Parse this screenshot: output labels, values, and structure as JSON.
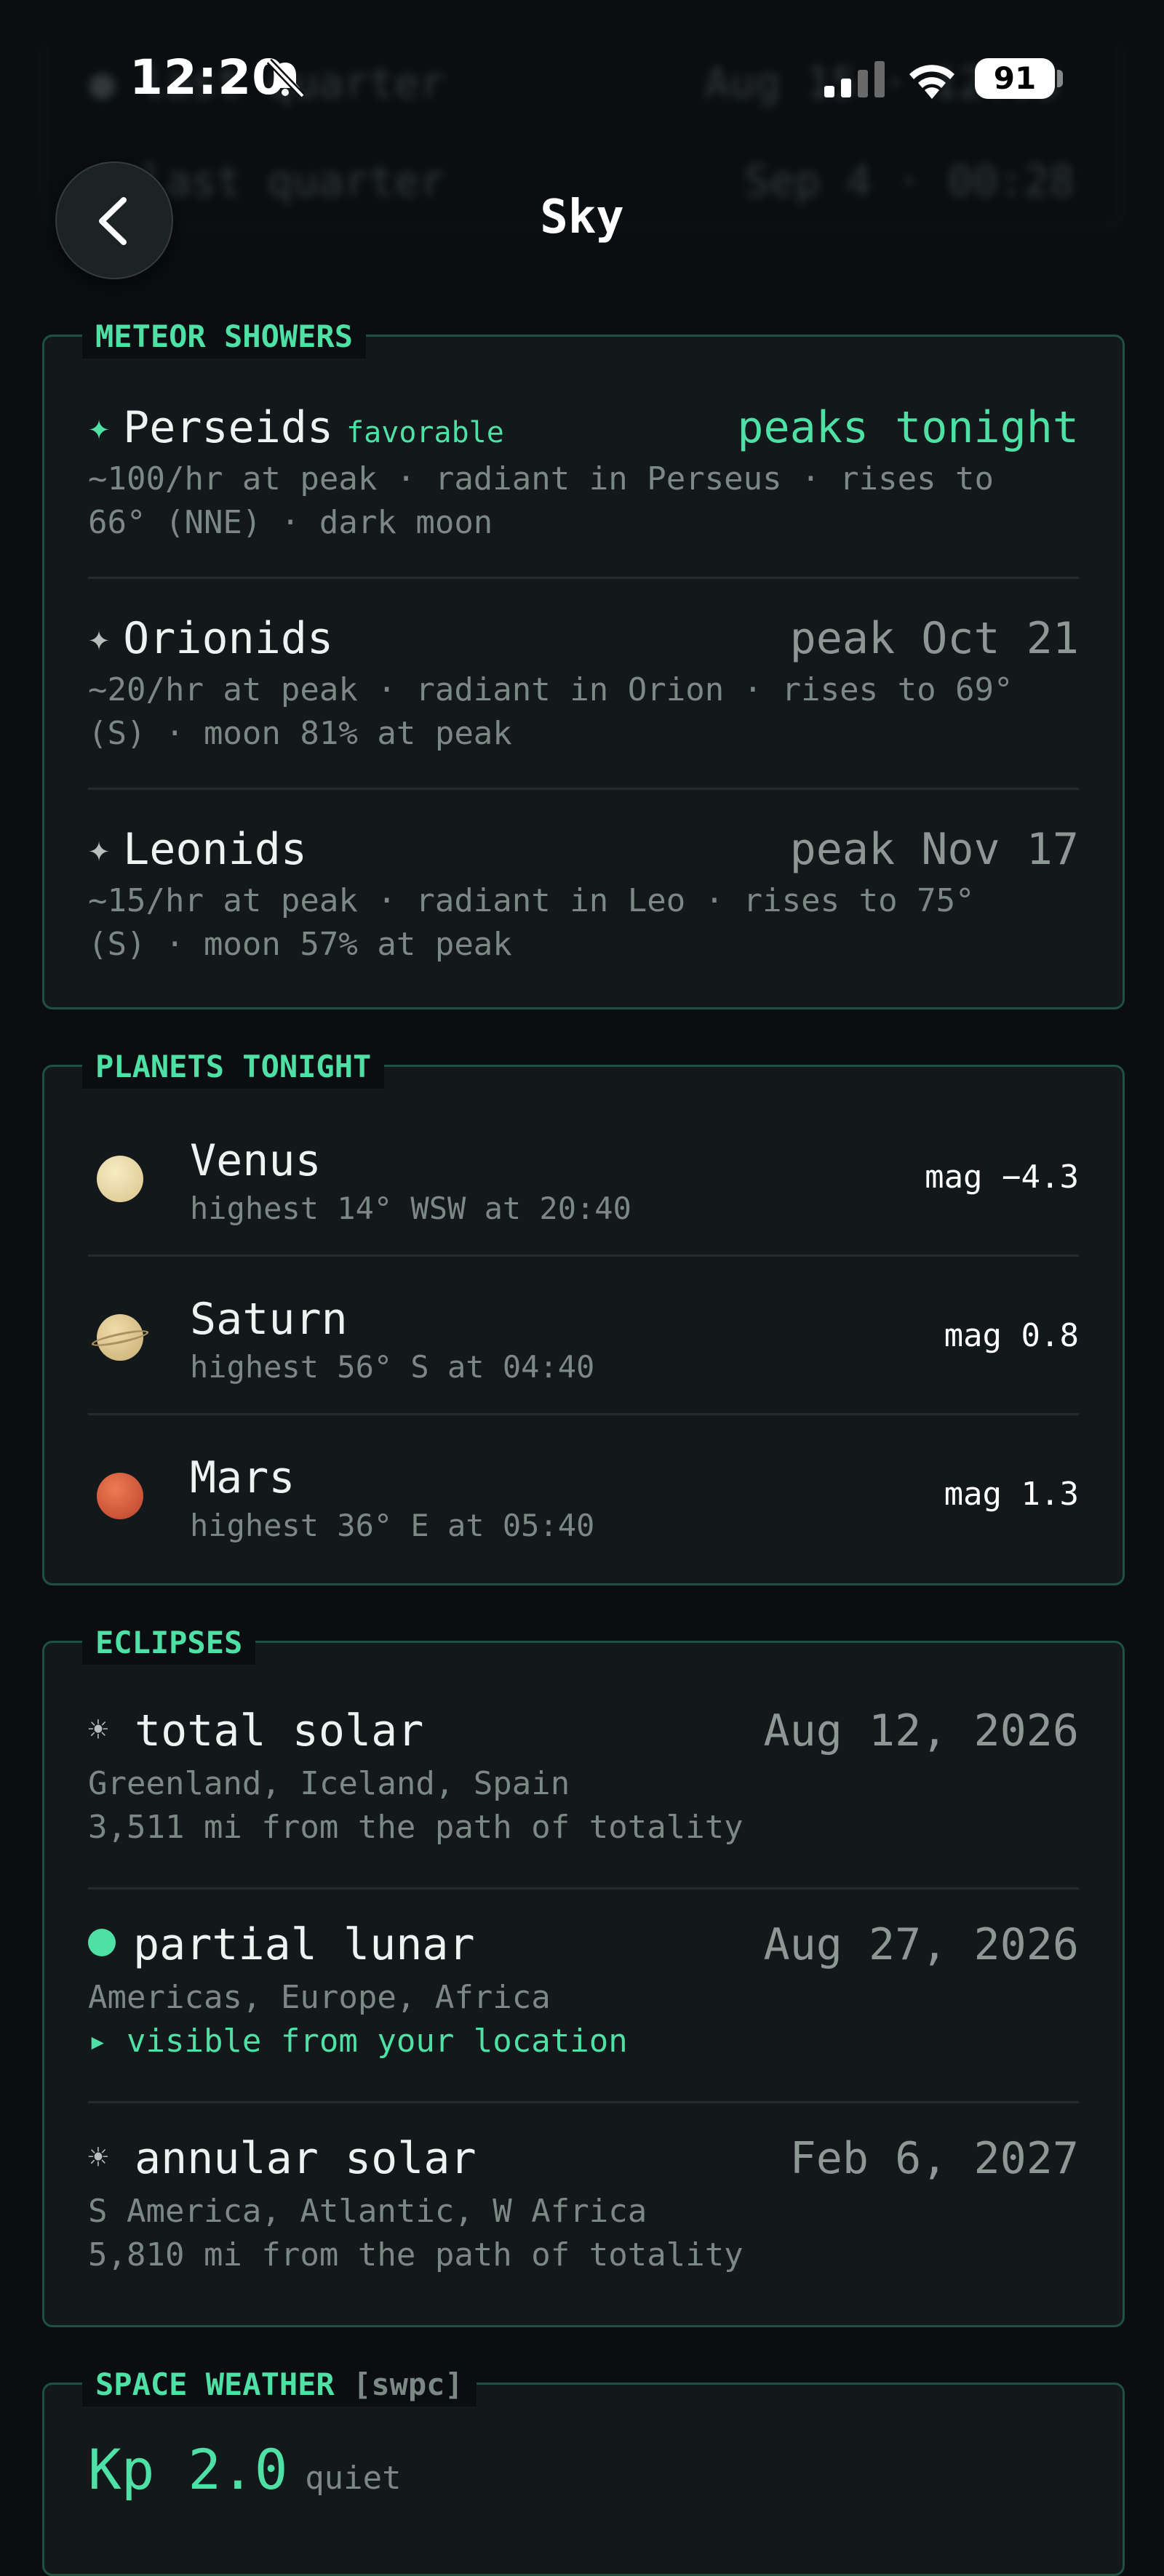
{
  "status_bar": {
    "time": "12:20",
    "battery": "91"
  },
  "background_ghost": {
    "row1_left": "● last quarter",
    "row1_right": "Aug 15 · 12:03",
    "row2_left": "● last quarter",
    "row2_right": "Sep 4 · 00:28"
  },
  "nav": {
    "title": "Sky",
    "back_icon": "chevron-left-icon"
  },
  "meteor_showers": {
    "label": "METEOR SHOWERS",
    "items": [
      {
        "name": "Perseids",
        "tag": "favorable",
        "when": "peaks tonight",
        "line1": "~100/hr at peak · radiant in Perseus · rises to",
        "line2": "66° (NNE) · dark moon"
      },
      {
        "name": "Orionids",
        "when": "peak Oct 21",
        "line1": "~20/hr at peak · radiant in Orion · rises to 69°",
        "line2": "(S) · moon 81% at peak"
      },
      {
        "name": "Leonids",
        "when": "peak Nov 17",
        "line1": "~15/hr at peak · radiant in Leo · rises to 75°",
        "line2": "(S) · moon 57% at peak"
      }
    ]
  },
  "planets": {
    "label": "PLANETS TONIGHT",
    "items": [
      {
        "name": "Venus",
        "desc": "highest 14° WSW at 20:40",
        "mag": "mag −4.3",
        "color": "#ecd9a2"
      },
      {
        "name": "Saturn",
        "desc": "highest 56° S at 04:40",
        "mag": "mag 0.8",
        "color": "#d8c08d"
      },
      {
        "name": "Mars",
        "desc": "highest 36° E at 05:40",
        "mag": "mag 1.3",
        "color": "#d2583a"
      }
    ]
  },
  "eclipses": {
    "label": "ECLIPSES",
    "items": [
      {
        "icon": "sun-icon",
        "name": "total solar",
        "date": "Aug 12, 2026",
        "line1": "Greenland, Iceland, Spain",
        "line2": "3,511 mi from the path of totality"
      },
      {
        "icon": "dot-icon",
        "name": "partial lunar",
        "date": "Aug 27, 2026",
        "line1": "Americas, Europe, Africa",
        "line2": "▸ visible from your location"
      },
      {
        "icon": "sun-icon",
        "name": "annular solar",
        "date": "Feb 6, 2027",
        "line1": "S America, Atlantic, W Africa",
        "line2": "5,810 mi from the path of totality"
      }
    ]
  },
  "space_weather": {
    "label": "SPACE WEATHER",
    "source": "[swpc]",
    "kp": "Kp 2.0",
    "kp_status": "quiet"
  }
}
